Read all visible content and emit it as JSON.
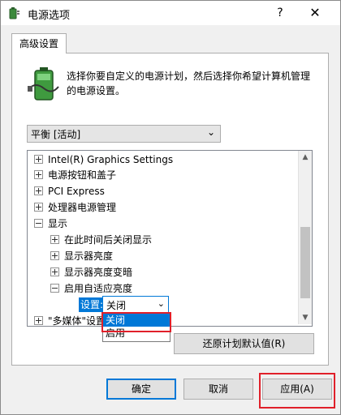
{
  "window": {
    "title": "电源选项",
    "help_label": "?",
    "close_label": "✕"
  },
  "tab": {
    "label": "高级设置"
  },
  "description": "选择你要自定义的电源计划，然后选择你希望计算机管理的电源设置。",
  "plan_select": {
    "value": "平衡 [活动]"
  },
  "tree": {
    "items": [
      {
        "label": "Intel(R) Graphics Settings",
        "expander": "+"
      },
      {
        "label": "电源按钮和盖子",
        "expander": "+"
      },
      {
        "label": "PCI Express",
        "expander": "+"
      },
      {
        "label": "处理器电源管理",
        "expander": "+"
      },
      {
        "label": "显示",
        "expander": "-"
      },
      {
        "label": "在此时间后关闭显示",
        "expander": "+"
      },
      {
        "label": "显示器亮度",
        "expander": "+"
      },
      {
        "label": "显示器亮度变暗",
        "expander": "+"
      },
      {
        "label": "启用自适应亮度",
        "expander": "-"
      },
      {
        "label": "\"多媒体\"设置",
        "expander": "+"
      }
    ],
    "setting_label": "设置:",
    "setting_value": "关闭",
    "options": [
      "关闭",
      "启用"
    ]
  },
  "buttons": {
    "restore": "还原计划默认值(R)",
    "ok": "确定",
    "cancel": "取消",
    "apply": "应用(A)"
  },
  "colors": {
    "accent": "#0078d7",
    "highlight_box": "#e0202a"
  },
  "icons": [
    "power-options-icon",
    "battery-plug-icon",
    "chevron-down-icon",
    "expand-icon",
    "collapse-icon"
  ]
}
